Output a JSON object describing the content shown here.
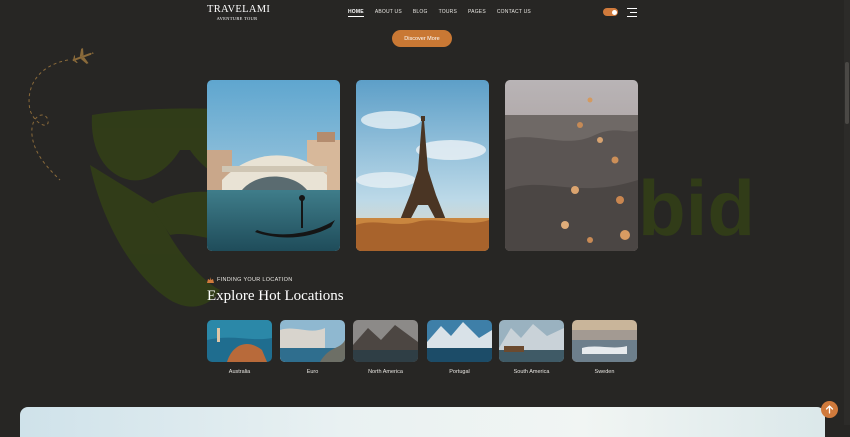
{
  "header": {
    "logo_title": "TRAVELAMI",
    "logo_subtitle": "AVENTURE TOUR",
    "nav": [
      "HOME",
      "ABOUT US",
      "BLOG",
      "TOURS",
      "PAGES",
      "CONTACT US"
    ],
    "active_nav": "HOME"
  },
  "hero": {
    "button_label": "Discover More"
  },
  "watermark_text": "bid",
  "section": {
    "eyebrow": "FINDING YOUR LOCATION",
    "title": "Explore Hot Locations"
  },
  "locations": [
    {
      "name": "Australia"
    },
    {
      "name": "Euro"
    },
    {
      "name": "North America"
    },
    {
      "name": "Portugal"
    },
    {
      "name": "South America"
    },
    {
      "name": "Sweden"
    }
  ],
  "colors": {
    "background": "#272624",
    "accent": "#c97834",
    "watermark": "#334116"
  }
}
